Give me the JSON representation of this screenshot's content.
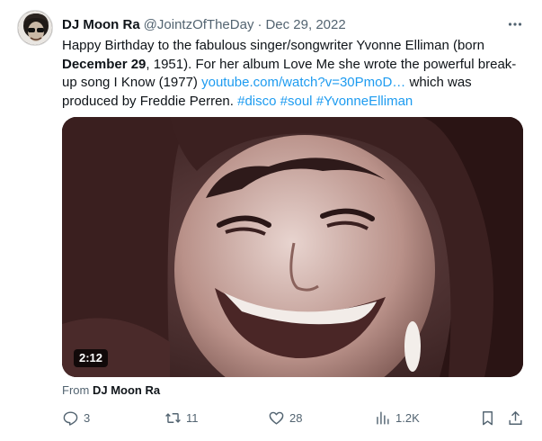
{
  "tweet": {
    "author_name": "DJ Moon Ra",
    "handle": "@JointzOfTheDay",
    "separator": "·",
    "date": "Dec 29, 2022",
    "text": {
      "part1": "Happy Birthday to the fabulous singer/songwriter Yvonne Elliman (born ",
      "bold": "December 29",
      "part2": ", 1951). For her album Love Me she wrote the powerful break-up song I Know (1977) ",
      "link": "youtube.com/watch?v=30PmoD…",
      "part3": " which was produced by Freddie Perren. ",
      "hashtags": [
        "#disco",
        "#soul",
        "#YvonneElliman"
      ]
    },
    "media": {
      "duration": "2:12"
    },
    "from": {
      "label": "From",
      "name": "DJ Moon Ra"
    },
    "actions": {
      "replies": "3",
      "retweets": "11",
      "likes": "28",
      "views": "1.2K"
    },
    "icons": [
      "more-icon",
      "reply-icon",
      "retweet-icon",
      "like-icon",
      "views-icon",
      "bookmark-icon",
      "share-icon"
    ],
    "colors": {
      "link": "#1d9bf0",
      "secondary_text": "#536471",
      "primary_text": "#0f1419"
    }
  }
}
